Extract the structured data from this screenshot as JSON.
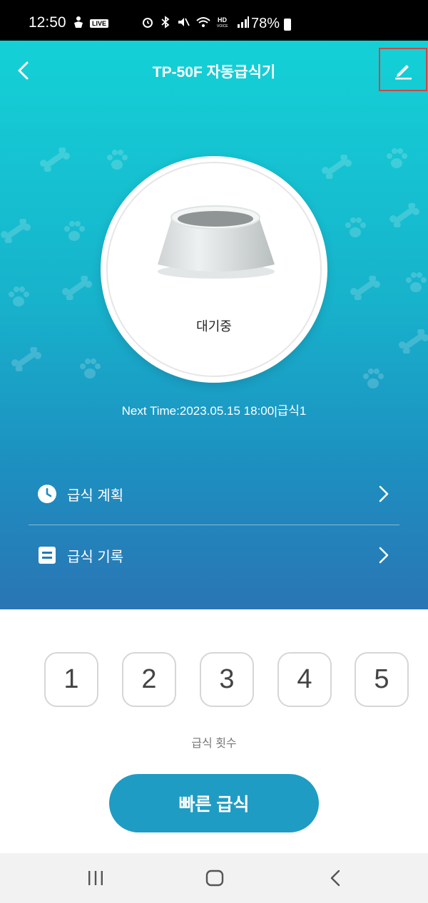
{
  "status_bar": {
    "time": "12:50",
    "live_badge": "LIVE",
    "battery": "78%"
  },
  "header": {
    "title": "TP-50F 자동급식기"
  },
  "feeder": {
    "status": "대기중",
    "next_time": "Next Time:2023.05.15 18:00|급식1"
  },
  "menu": [
    {
      "label": "급식 계획",
      "icon": "clock-icon"
    },
    {
      "label": "급식 기록",
      "icon": "list-icon"
    }
  ],
  "feed_count": {
    "options": [
      "1",
      "2",
      "3",
      "4",
      "5"
    ],
    "label": "급식 횟수"
  },
  "quick_feed": {
    "label": "빠른 급식"
  },
  "colors": {
    "gradient_top": "#14d1d6",
    "gradient_bottom": "#2a75b4",
    "accent": "#1f9cc4"
  }
}
